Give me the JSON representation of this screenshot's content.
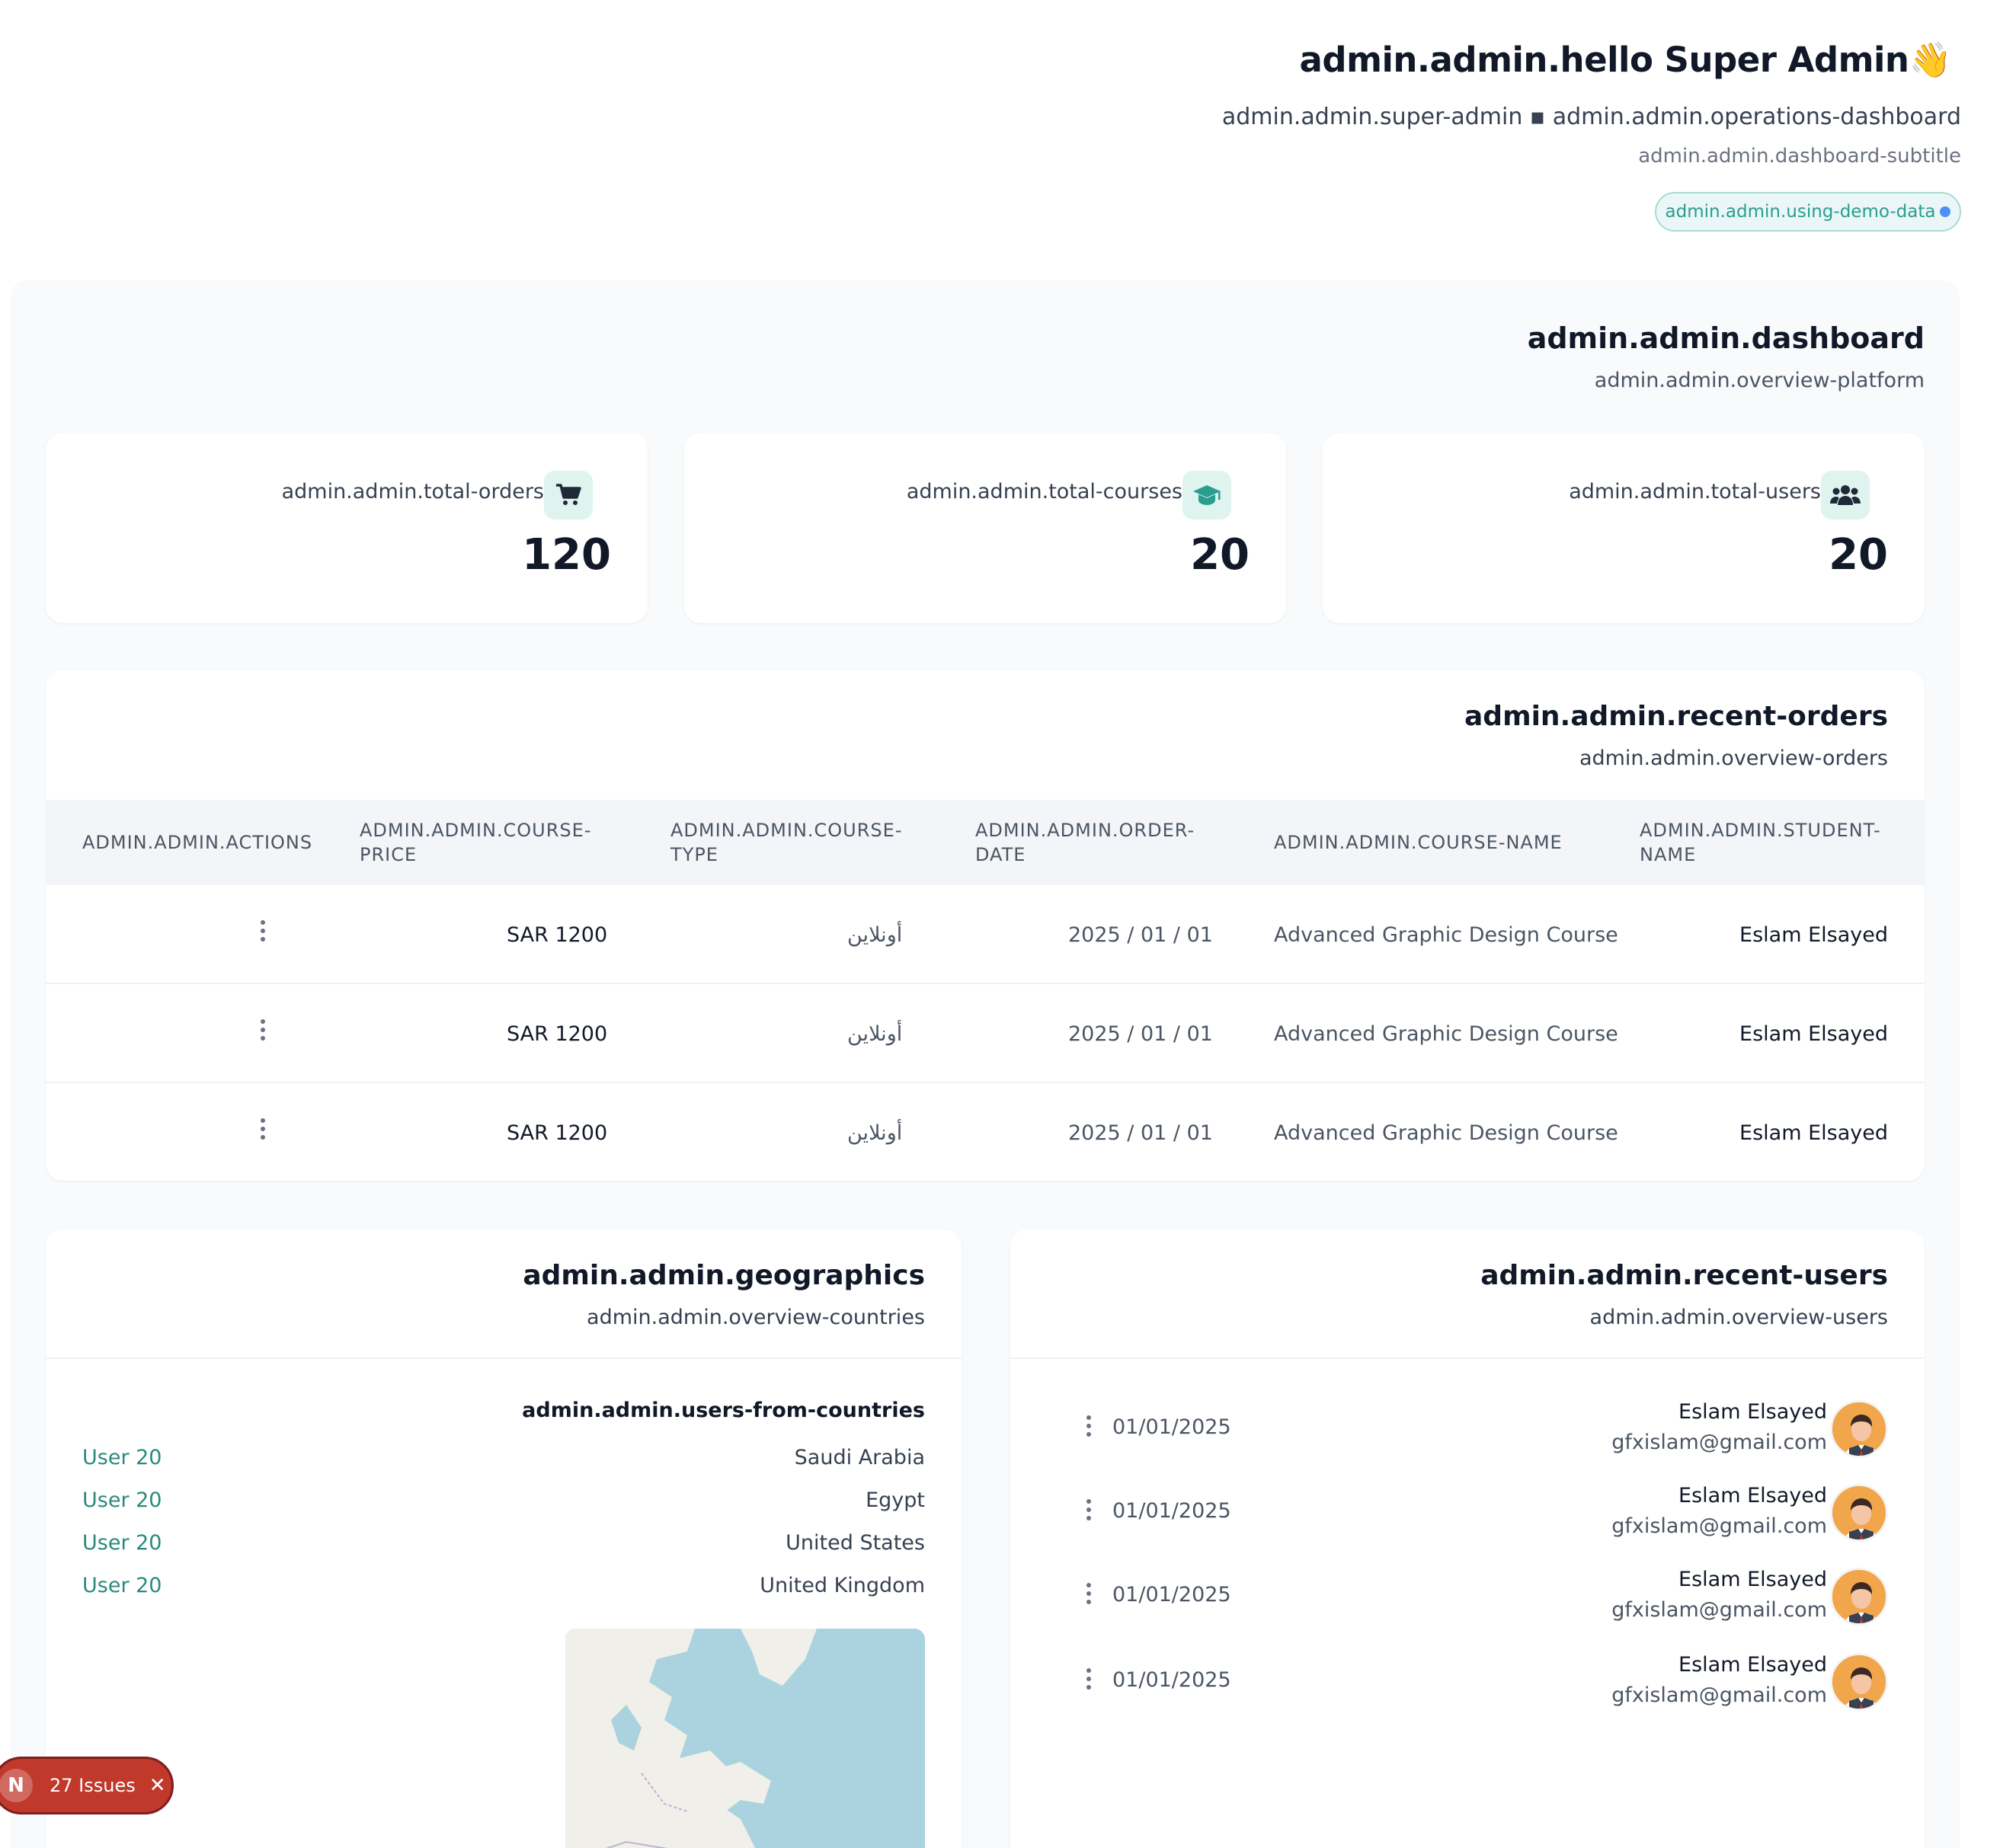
{
  "header": {
    "greeting": "admin.admin.hello Super Admin",
    "greeting_emoji": "👋",
    "roles_line": "admin.admin.super-admin ▪ admin.admin.operations-dashboard",
    "subtitle": "admin.admin.dashboard-subtitle",
    "demo_badge": "admin.admin.using-demo-data"
  },
  "dashboard": {
    "title": "admin.admin.dashboard",
    "subtitle": "admin.admin.overview-platform"
  },
  "stats": [
    {
      "label": "admin.admin.total-orders",
      "value": "120",
      "icon": "cart-icon"
    },
    {
      "label": "admin.admin.total-courses",
      "value": "20",
      "icon": "graduation-cap-icon"
    },
    {
      "label": "admin.admin.total-users",
      "value": "20",
      "icon": "users-icon"
    }
  ],
  "recent_orders": {
    "title": "admin.admin.recent-orders",
    "subtitle": "admin.admin.overview-orders",
    "columns": {
      "actions": "ADMIN.ADMIN.ACTIONS",
      "course_price": "ADMIN.ADMIN.COURSE- PRICE",
      "course_type": "ADMIN.ADMIN.COURSE- TYPE",
      "order_date": "ADMIN.ADMIN.ORDER- DATE",
      "course_name": "ADMIN.ADMIN.COURSE-NAME",
      "student_name": "ADMIN.ADMIN.STUDENT- NAME"
    },
    "rows": [
      {
        "price": "SAR 1200",
        "type": "أونلاين",
        "date": "2025 / 01 / 01",
        "course": "Advanced Graphic Design Course",
        "student": "Eslam Elsayed"
      },
      {
        "price": "SAR 1200",
        "type": "أونلاين",
        "date": "2025 / 01 / 01",
        "course": "Advanced Graphic Design Course",
        "student": "Eslam Elsayed"
      },
      {
        "price": "SAR 1200",
        "type": "أونلاين",
        "date": "2025 / 01 / 01",
        "course": "Advanced Graphic Design Course",
        "student": "Eslam Elsayed"
      }
    ]
  },
  "geographics": {
    "title": "admin.admin.geographics",
    "subtitle": "admin.admin.overview-countries",
    "list_header": "admin.admin.users-from-countries",
    "rows": [
      {
        "users": "User 20",
        "country": "Saudi Arabia"
      },
      {
        "users": "User 20",
        "country": "Egypt"
      },
      {
        "users": "User 20",
        "country": "United States"
      },
      {
        "users": "User 20",
        "country": "United Kingdom"
      }
    ]
  },
  "recent_users": {
    "title": "admin.admin.recent-users",
    "subtitle": "admin.admin.overview-users",
    "rows": [
      {
        "date": "01/01/2025",
        "name": "Eslam Elsayed",
        "email": "gfxislam@gmail.com"
      },
      {
        "date": "01/01/2025",
        "name": "Eslam Elsayed",
        "email": "gfxislam@gmail.com"
      },
      {
        "date": "01/01/2025",
        "name": "Eslam Elsayed",
        "email": "gfxislam@gmail.com"
      },
      {
        "date": "01/01/2025",
        "name": "Eslam Elsayed",
        "email": "gfxislam@gmail.com"
      }
    ]
  },
  "dev_overlay": {
    "issues_label": "27 Issues",
    "logo_letter": "N"
  },
  "colors": {
    "accent": "#2a9d8f",
    "issues_red": "#c0392b",
    "icon_bg": "#dff3ef"
  }
}
